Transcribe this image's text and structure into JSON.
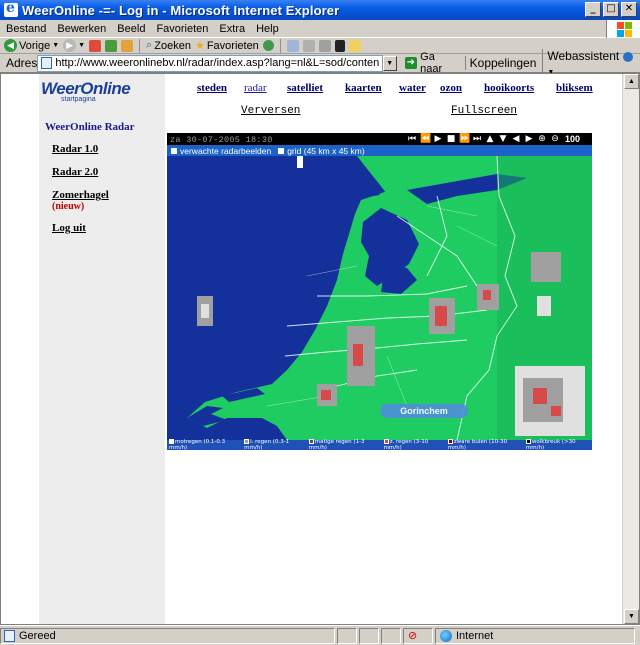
{
  "window": {
    "title": "WeerOnline -=- Log in - Microsoft Internet Explorer",
    "buttons": {
      "minimize": "_",
      "maximize": "□",
      "close": "✕"
    }
  },
  "menu": [
    "Bestand",
    "Bewerken",
    "Beeld",
    "Favorieten",
    "Extra",
    "Help"
  ],
  "toolbar": {
    "back": "Vorige",
    "search": "Zoeken",
    "favorites": "Favorieten"
  },
  "address": {
    "label": "Adres",
    "url": "http://www.weeronlinebv.nl/radar/index.asp?lang=nl&L=sod/content.asp?lang=nl",
    "go": "Ga naar",
    "links": "Koppelingen",
    "webassistent": "Webassistent"
  },
  "site": {
    "logo": "WeerOnline",
    "logo_tag": "startpagina",
    "nav": [
      "steden",
      "radar",
      "satelliet",
      "kaarten",
      "water",
      "ozon",
      "hooikoorts",
      "bliksem"
    ],
    "active_nav": "radar"
  },
  "sidebar": {
    "title": "WeerOnline Radar",
    "links": [
      "Radar 1.0",
      "Radar 2.0",
      "Zomerhagel",
      "Log uit"
    ],
    "new_label": "(nieuw)"
  },
  "radar": {
    "refresh": "Verversen",
    "fullscreen": "Fullscreen",
    "timestamp": "za 30-07-2005 18:30",
    "zoom": "100",
    "option1": "verwachte radarbeelden",
    "option2": "grid (45 km x 45 km)",
    "city": "Gorinchem",
    "legend": [
      {
        "label": "motregen (0.1-0.3 mm/h)",
        "color": "#ffffff"
      },
      {
        "label": "l. regen (0.3-1 mm/h)",
        "color": "#a0a0a0"
      },
      {
        "label": "matige regen (1-3 mm/h)",
        "color": "#505050"
      },
      {
        "label": "z. regen (3-10 mm/h)",
        "color": "#d64a4a"
      },
      {
        "label": "zware buien (10-30 mm/h)",
        "color": "#8a0000"
      },
      {
        "label": "wolkbreuk (>30 mm/h)",
        "color": "#000000"
      }
    ],
    "colors": {
      "sea": "#14309a",
      "land": "#1ecc62",
      "rain_red": "#d64a4a"
    }
  },
  "status": {
    "text": "Gereed",
    "zone": "Internet"
  }
}
